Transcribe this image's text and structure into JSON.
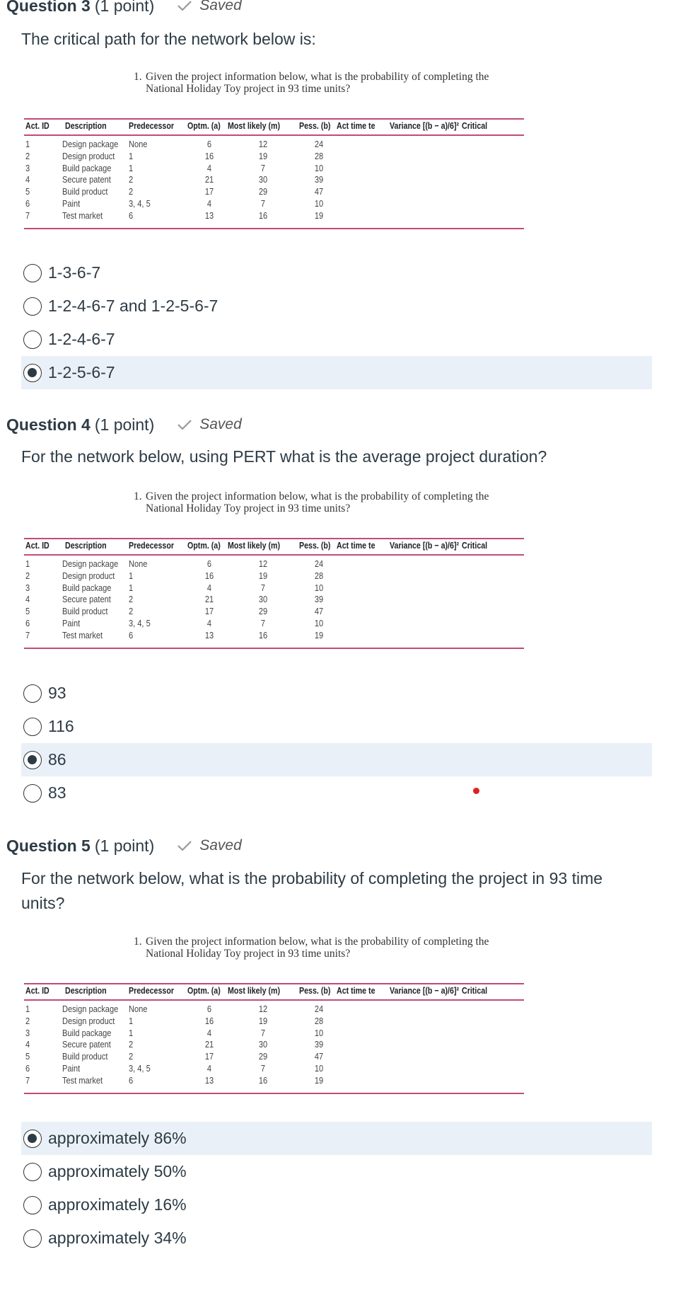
{
  "questions": [
    {
      "title": "Question 3",
      "points": "(1 point)",
      "status": "Saved",
      "prompt": "The critical path for the network below is:",
      "options": [
        {
          "label": "1-3-6-7",
          "selected": false
        },
        {
          "label": "1-2-4-6-7 and 1-2-5-6-7",
          "selected": false
        },
        {
          "label": "1-2-4-6-7",
          "selected": false
        },
        {
          "label": "1-2-5-6-7",
          "selected": true
        }
      ]
    },
    {
      "title": "Question 4",
      "points": "(1 point)",
      "status": "Saved",
      "prompt": "For the network below, using PERT what is the average project duration?",
      "options": [
        {
          "label": "93",
          "selected": false
        },
        {
          "label": "116",
          "selected": false
        },
        {
          "label": "86",
          "selected": true
        },
        {
          "label": "83",
          "selected": false
        }
      ]
    },
    {
      "title": "Question 5",
      "points": "(1 point)",
      "status": "Saved",
      "prompt": "For the network below, what is the probability of completing the project in 93 time units?",
      "options": [
        {
          "label": "approximately 86%",
          "selected": true
        },
        {
          "label": "approximately 50%",
          "selected": false
        },
        {
          "label": "approximately 16%",
          "selected": false
        },
        {
          "label": "approximately 34%",
          "selected": false
        }
      ]
    }
  ],
  "table_image": {
    "caption_number": "1.",
    "caption_line1": "Given the project information below, what is the probability of completing the",
    "caption_line2": "National Holiday Toy project in 93 time units?",
    "headers": [
      "Act. ID",
      "Description",
      "Predecessor",
      "Optm. (a)",
      "Most likely (m)",
      "Pess. (b)",
      "Act time te",
      "Variance [(b − a)/6]²",
      "Critical"
    ],
    "rows": [
      [
        "1",
        "Design package",
        "None",
        "6",
        "12",
        "24"
      ],
      [
        "2",
        "Design product",
        "1",
        "16",
        "19",
        "28"
      ],
      [
        "3",
        "Build package",
        "1",
        "4",
        "7",
        "10"
      ],
      [
        "4",
        "Secure patent",
        "2",
        "21",
        "30",
        "39"
      ],
      [
        "5",
        "Build product",
        "2",
        "17",
        "29",
        "47"
      ],
      [
        "6",
        "Paint",
        "3, 4, 5",
        "4",
        "7",
        "10"
      ],
      [
        "7",
        "Test market",
        "6",
        "13",
        "16",
        "19"
      ]
    ]
  },
  "colors": {
    "table_rule": "#c24a7a",
    "selected_bg": "#eaf0f8",
    "marker_dot": "#e02020"
  }
}
